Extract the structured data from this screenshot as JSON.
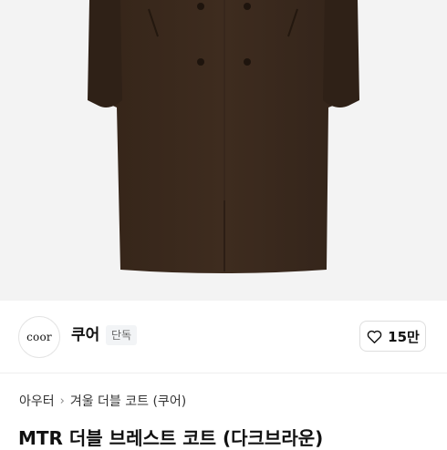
{
  "product": {
    "image_alt": "dark brown double-breasted long coat",
    "title": "MTR 더블 브레스트 코트 (다크브라운)"
  },
  "brand": {
    "logo_text": "coor",
    "name": "쿠어",
    "badge": "단독"
  },
  "like": {
    "icon": "heart-outline-icon",
    "count": "15만"
  },
  "breadcrumb": {
    "items": [
      "아우터",
      "겨울 더블 코트 (쿠어)"
    ],
    "separator": "›"
  },
  "colors": {
    "coat": "#3b2a1e",
    "image_background": "#f3f3f3",
    "badge_background": "#f2f4f6"
  }
}
